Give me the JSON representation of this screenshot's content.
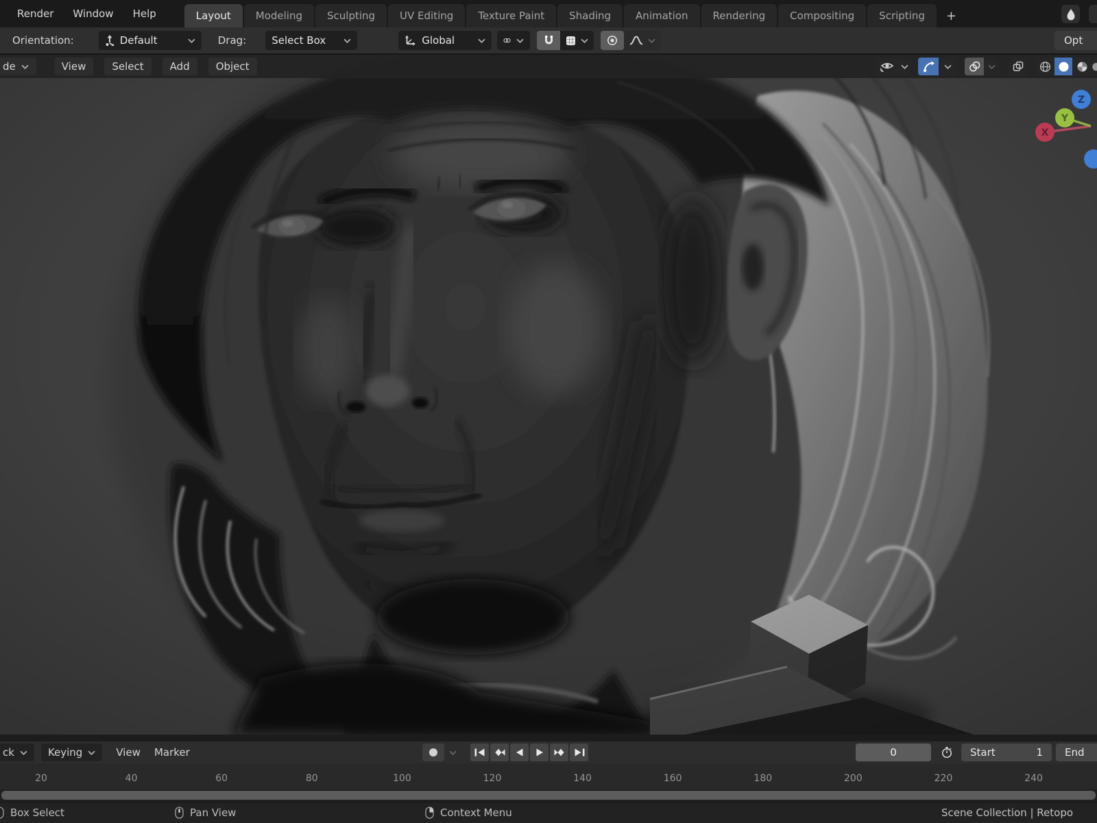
{
  "topbar": {
    "menus": [
      "Render",
      "Window",
      "Help"
    ],
    "tabs": [
      "Layout",
      "Modeling",
      "Sculpting",
      "UV Editing",
      "Texture Paint",
      "Shading",
      "Animation",
      "Rendering",
      "Compositing",
      "Scripting"
    ],
    "active_tab": "Layout",
    "add_tab_label": "+"
  },
  "tool_settings": {
    "orientation_label": "Orientation:",
    "orientation_value": "Default",
    "drag_label": "Drag:",
    "drag_value": "Select Box",
    "transform_orientation_value": "Global",
    "options_label": "Opt"
  },
  "viewport_header": {
    "mode_value": "de",
    "menus": [
      "View",
      "Select",
      "Add",
      "Object"
    ]
  },
  "gizmo": {
    "x": "X",
    "y": "Y",
    "z": "Z"
  },
  "timeline": {
    "playback_menu": "ck",
    "keying_menu": "Keying",
    "view_menu": "View",
    "marker_menu": "Marker",
    "current_frame": "0",
    "start_label": "Start",
    "start_value": "1",
    "end_label": "End",
    "ruler_ticks": [
      "20",
      "40",
      "60",
      "80",
      "100",
      "120",
      "140",
      "160",
      "180",
      "200",
      "220",
      "240"
    ]
  },
  "status_bar": {
    "box_select": "Box Select",
    "pan_view": "Pan View",
    "context_menu": "Context Menu",
    "scene_info": "Scene Collection | Retopo"
  },
  "colors": {
    "accent": "#4772b3",
    "axis_x": "#bb3b55",
    "axis_y": "#9ac043",
    "axis_z": "#3f7fd6"
  }
}
